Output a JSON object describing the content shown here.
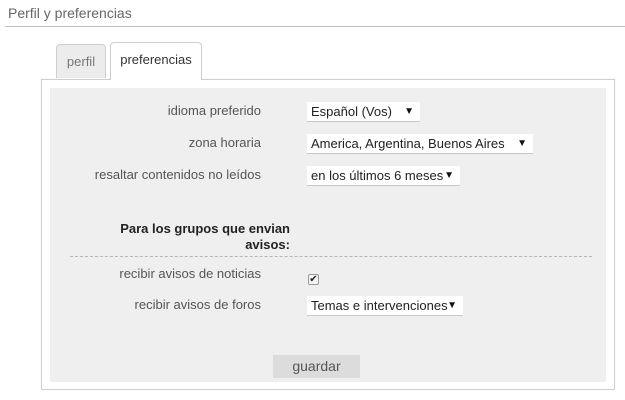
{
  "page": {
    "title": "Perfil y preferencias"
  },
  "tabs": [
    {
      "label": "perfil",
      "active": false
    },
    {
      "label": "preferencias",
      "active": true
    }
  ],
  "form": {
    "language": {
      "label": "idioma preferido",
      "value": "Español (Vos)",
      "icon": "chevron-down-icon"
    },
    "timezone": {
      "label": "zona horaria",
      "value": "America, Argentina, Buenos Aires",
      "icon": "chevron-down-icon"
    },
    "highlight": {
      "label": "resaltar contenidos no leídos",
      "value": "en los últimos 6 meses",
      "icon": "chevron-down-icon"
    },
    "group_heading": "Para los grupos que envian avisos:",
    "news_notices": {
      "label": "recibir avisos de noticias",
      "checked": true,
      "icon": "checkmark-icon"
    },
    "forum_notices": {
      "label": "recibir avisos de foros",
      "value": "Temas e intervenciones",
      "icon": "chevron-down-icon"
    },
    "save_label": "guardar"
  },
  "glyphs": {
    "dropdown_arrow": "▼",
    "checkmark": "✔"
  },
  "colors": {
    "panel_background": "#efefef",
    "button_background": "#dcdcdc"
  }
}
